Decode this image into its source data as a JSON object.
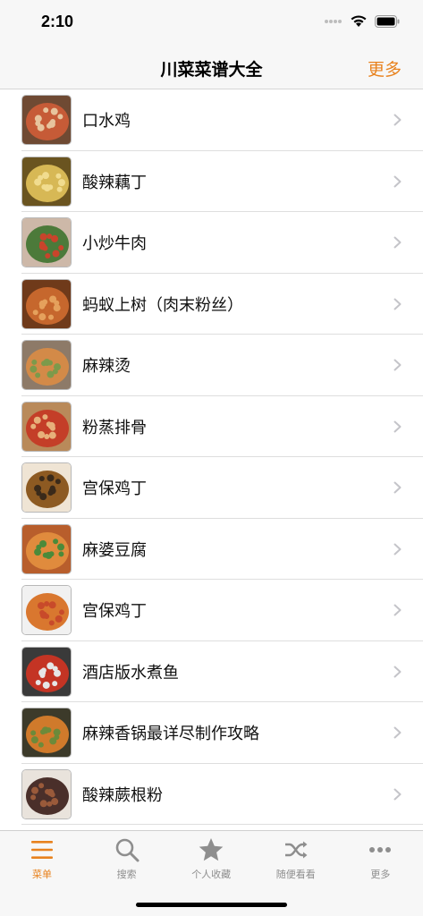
{
  "status": {
    "time": "2:10"
  },
  "nav": {
    "title": "川菜菜谱大全",
    "more_label": "更多"
  },
  "recipes": [
    {
      "label": "口水鸡",
      "palette": [
        "#6f4a33",
        "#c65b37",
        "#e7c49d"
      ]
    },
    {
      "label": "酸辣藕丁",
      "palette": [
        "#6a5420",
        "#d7b855",
        "#f1dc8f"
      ]
    },
    {
      "label": "小炒牛肉",
      "palette": [
        "#cdb8a8",
        "#4c7a3a",
        "#c8442b"
      ]
    },
    {
      "label": "蚂蚁上树（肉末粉丝）",
      "palette": [
        "#6f3a1a",
        "#c6672d",
        "#e5a15c"
      ]
    },
    {
      "label": "麻辣烫",
      "palette": [
        "#8d7a68",
        "#d38a48",
        "#7c9a4b"
      ]
    },
    {
      "label": "粉蒸排骨",
      "palette": [
        "#b98a5a",
        "#c43e28",
        "#e7b07a"
      ]
    },
    {
      "label": "宫保鸡丁",
      "palette": [
        "#efe4d4",
        "#8d5a22",
        "#3a2a1a"
      ]
    },
    {
      "label": "麻婆豆腐",
      "palette": [
        "#b85e2c",
        "#e08b3d",
        "#4b8a3a"
      ]
    },
    {
      "label": "宫保鸡丁",
      "palette": [
        "#f1f1f1",
        "#d9772f",
        "#c84a2a"
      ]
    },
    {
      "label": "酒店版水煮鱼",
      "palette": [
        "#3a3a3a",
        "#c43424",
        "#e6e6e6"
      ]
    },
    {
      "label": "麻辣香锅最详尽制作攻略",
      "palette": [
        "#3c3a2a",
        "#d07a2b",
        "#6c8a3a"
      ]
    },
    {
      "label": "酸辣蕨根粉",
      "palette": [
        "#e9e3dc",
        "#4a2f2a",
        "#9a5a3a"
      ]
    }
  ],
  "tabs": [
    {
      "label": "菜单",
      "icon": "menu-icon",
      "active": true
    },
    {
      "label": "搜索",
      "icon": "search-icon",
      "active": false
    },
    {
      "label": "个人收藏",
      "icon": "star-icon",
      "active": false
    },
    {
      "label": "随便看看",
      "icon": "shuffle-icon",
      "active": false
    },
    {
      "label": "更多",
      "icon": "more-dots-icon",
      "active": false
    }
  ],
  "colors": {
    "accent": "#e8821e",
    "inactive": "#8e8e8e",
    "bar_bg": "#f7f7f7",
    "separator": "#dedede"
  }
}
